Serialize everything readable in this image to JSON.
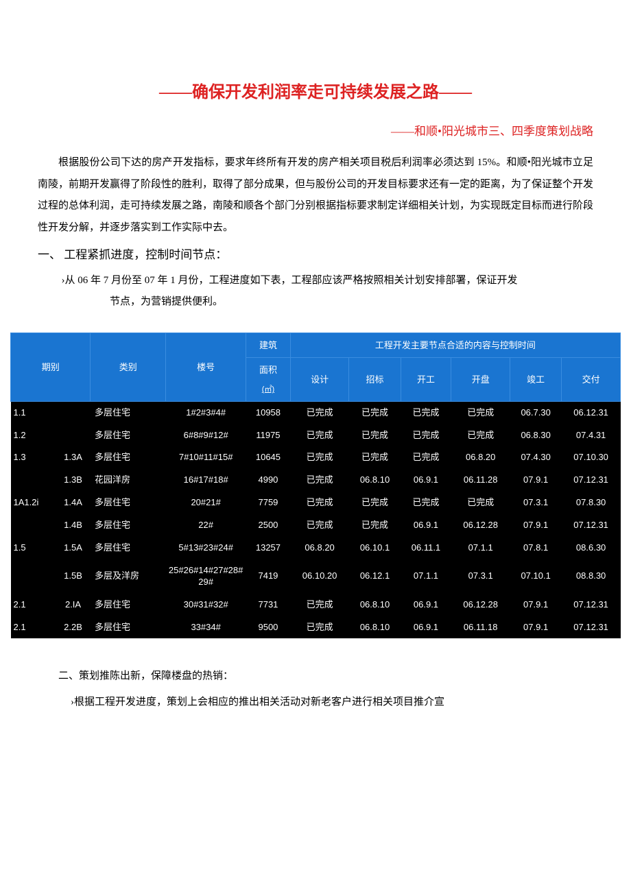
{
  "title": "——确保开发利润率走可持续发展之路——",
  "subtitle": "——和顺•阳光城市三、四季度策划战略",
  "intro": "根据股份公司下达的房产开发指标，要求年终所有开发的房产相关项目税后利润率必须达到 15%。和顺•阳光城市立足南陵，前期开发赢得了阶段性的胜利，取得了部分成果，但与股份公司的开发目标要求还有一定的距离，为了保证整个开发过程的总体利润，走可持续发展之路，南陵和顺各个部门分别根据指标要求制定详细相关计划，为实现既定目标而进行阶段性开发分解，并逐步落实到工作实际中去。",
  "section1_head": "一、 工程紧抓进度，控制时间节点：",
  "section1_bullet": "›从 06 年 7 月份至 07 年 1 月份，工程进度如下表，工程部应该严格按照相关计划安排部署，保证开发",
  "section1_bullet_cont": "节点，为营销提供便利。",
  "table": {
    "header_group": "工程开发主要节点合适的内容与控制时间",
    "col_period": "期别",
    "col_type": "类别",
    "col_building": "楼号",
    "col_area_top": "建筑",
    "col_area": "面积",
    "col_area_unit": "(㎡)",
    "col_design": "设计",
    "col_bid": "招标",
    "col_start": "开工",
    "col_open": "开盘",
    "col_finish": "竣工",
    "col_deliver": "交付",
    "rows": [
      {
        "g": "1.1",
        "sub": "",
        "type": "多层住宅",
        "bld": "1#2#3#4#",
        "area": "10958",
        "design": "已完成",
        "bid": "已完成",
        "start": "已完成",
        "open": "已完成",
        "finish": "06.7.30",
        "deliver": "06.12.31"
      },
      {
        "g": "1.2",
        "sub": "",
        "type": "多层住宅",
        "bld": "6#8#9#12#",
        "area": "11975",
        "design": "已完成",
        "bid": "已完成",
        "start": "已完成",
        "open": "已完成",
        "finish": "06.8.30",
        "deliver": "07.4.31"
      },
      {
        "g": "1.3",
        "sub": "1.3A",
        "type": "多层住宅",
        "bld": "7#10#11#15#",
        "area": "10645",
        "design": "已完成",
        "bid": "已完成",
        "start": "已完成",
        "open": "06.8.20",
        "finish": "07.4.30",
        "deliver": "07.10.30"
      },
      {
        "g": "",
        "sub": "1.3B",
        "type": "花园洋房",
        "bld": "16#17#18#",
        "area": "4990",
        "design": "已完成",
        "bid": "06.8.10",
        "start": "06.9.1",
        "open": "06.11.28",
        "finish": "07.9.1",
        "deliver": "07.12.31"
      },
      {
        "g": "1A1.2i",
        "sub": "1.4A",
        "type": "多层住宅",
        "bld": "20#21#",
        "area": "7759",
        "design": "已完成",
        "bid": "已完成",
        "start": "已完成",
        "open": "已完成",
        "finish": "07.3.1",
        "deliver": "07.8.30"
      },
      {
        "g": "",
        "sub": "1.4B",
        "type": "多层住宅",
        "bld": "22#",
        "area": "2500",
        "design": "已完成",
        "bid": "已完成",
        "start": "06.9.1",
        "open": "06.12.28",
        "finish": "07.9.1",
        "deliver": "07.12.31"
      },
      {
        "g": "1.5",
        "sub": "1.5A",
        "type": "多层住宅",
        "bld": "5#13#23#24#",
        "area": "13257",
        "design": "06.8.20",
        "bid": "06.10.1",
        "start": "06.11.1",
        "open": "07.1.1",
        "finish": "07.8.1",
        "deliver": "08.6.30"
      },
      {
        "g": "",
        "sub": "1.5B",
        "type": "多层及洋房",
        "bld": "25#26#14#27#28#29#",
        "area": "7419",
        "design": "06.10.20",
        "bid": "06.12.1",
        "start": "07.1.1",
        "open": "07.3.1",
        "finish": "07.10.1",
        "deliver": "08.8.30"
      },
      {
        "g": "2.1",
        "sub": "2.IA",
        "type": "多层住宅",
        "bld": "30#31#32#",
        "area": "7731",
        "design": "已完成",
        "bid": "06.8.10",
        "start": "06.9.1",
        "open": "06.12.28",
        "finish": "07.9.1",
        "deliver": "07.12.31"
      },
      {
        "g": "2.1",
        "sub": "2.2B",
        "type": "多层住宅",
        "bld": "33#34#",
        "area": "9500",
        "design": "已完成",
        "bid": "06.8.10",
        "start": "06.9.1",
        "open": "06.11.18",
        "finish": "07.9.1",
        "deliver": "07.12.31"
      }
    ]
  },
  "section2_head": "二、策划推陈出新，保障楼盘的热销：",
  "section2_bullet": "›根据工程开发进度，策划上会相应的推出相关活动对新老客户进行相关项目推介宣"
}
